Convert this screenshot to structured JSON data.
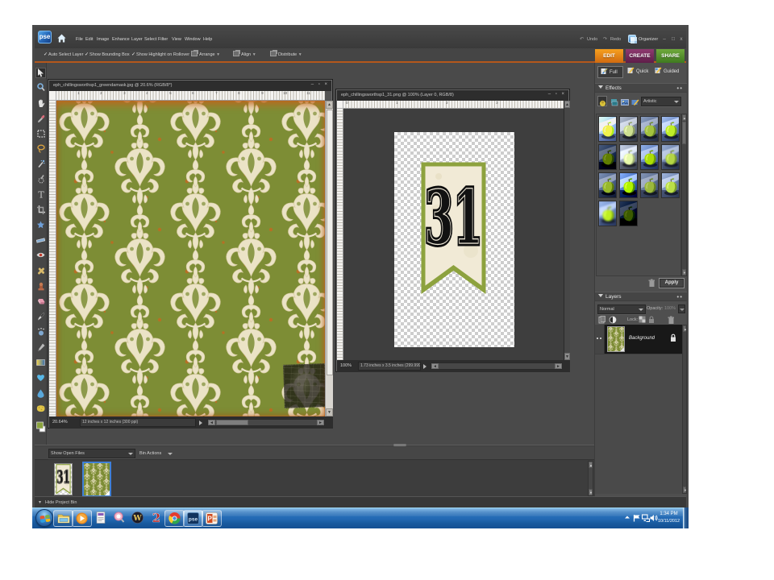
{
  "app": {
    "menu_bar": {
      "logo_text": "pse",
      "menus": [
        "File",
        "Edit",
        "Image",
        "Enhance",
        "Layer",
        "Select",
        "Filter",
        "View",
        "Window",
        "Help"
      ],
      "undo_label": "Undo",
      "redo_label": "Redo",
      "organizer_label": "Organizer",
      "window_buttons": {
        "minimize": "–",
        "maximize": "□",
        "close": "x"
      }
    },
    "options_bar": {
      "checkboxes": [
        "Auto Select Layer",
        "Show Bounding Box",
        "Show Highlight on Rollover"
      ],
      "buttons": [
        "Arrange",
        "Align",
        "Distribute"
      ]
    },
    "tabs": [
      {
        "label": "EDIT",
        "color": "#e2841c",
        "active": true
      },
      {
        "label": "CREATE",
        "color": "#8c3a6e",
        "active": false
      },
      {
        "label": "SHARE",
        "color": "#569a2e",
        "active": false
      }
    ],
    "mode_buttons": [
      "Full",
      "Quick",
      "Guided"
    ],
    "toolbox": {
      "tools": [
        "move",
        "zoom",
        "hand",
        "eyedropper",
        "rectangular-marquee",
        "lasso",
        "magic-wand",
        "quick-selection",
        "type",
        "crop",
        "cookie-cutter",
        "straighten",
        "red-eye-removal",
        "spot-healing-brush",
        "clone-stamp",
        "eraser",
        "brush",
        "smart-brush",
        "pencil",
        "gradient",
        "shape",
        "blur",
        "sponge"
      ],
      "selected_tool": "move"
    },
    "documents": [
      {
        "title": "eph_chillingsworthsp1_greendamask.jpg @ 20.6% (RGB/8*)",
        "zoom": "20.64%",
        "info": "12 inches x 12 inches (300 ppi)",
        "ruler_numbers": [
          "1",
          "2",
          "3",
          "4",
          "5",
          "6",
          "7",
          "8",
          "9",
          "10",
          "11"
        ]
      },
      {
        "title": "eph_chillingsworthsp1_31.png @ 100% (Layer 0, RGB/8)",
        "zoom": "100%",
        "info": "1.73 inches x 3.5 inches (299.999 ppi)",
        "ruler_numbers": [
          "0",
          "1",
          "2",
          "3"
        ],
        "banner_text": "31"
      }
    ],
    "effects_panel": {
      "title": "Effects",
      "category": "Artistic",
      "apply_label": "Apply",
      "thumbnail_count": 14
    },
    "layers_panel": {
      "title": "Layers",
      "blend_mode": "Normal",
      "opacity_label": "Opacity:",
      "opacity_value": "100%",
      "lock_label": "Lock:",
      "layers": [
        {
          "name": "Background",
          "locked": true
        }
      ]
    },
    "project_bin": {
      "show_open_files": "Show Open Files",
      "bin_actions": "Bin Actions",
      "hide_label": "Hide Project Bin",
      "thumbnails": [
        "eph_chillingsworthsp1_31.png",
        "eph_chillingsworthsp1_greendamask.jpg"
      ],
      "selected_thumbnail": 1,
      "thumb1_text": "31"
    }
  },
  "taskbar": {
    "icons": [
      "start",
      "windows-explorer",
      "media-player",
      "document",
      "photo-viewer",
      "world-of-warcraft",
      "two",
      "chrome",
      "photoshop-elements",
      "powerpoint"
    ],
    "tray_icons": [
      "hidden-icons",
      "action-center",
      "network",
      "volume"
    ],
    "clock": {
      "time": "1:34 PM",
      "date": "10/11/2012"
    }
  },
  "colors": {
    "accent_orange": "#b4571c",
    "tab_edit": "#e2841c",
    "tab_create": "#8c3a6e",
    "tab_share": "#569a2e",
    "selection_blue": "#3f80d8",
    "damask_green": "#7c8c34",
    "damask_cream": "#ebe3c6",
    "damask_orange": "#c4671f",
    "taskbar_blue": "#2268b3"
  }
}
